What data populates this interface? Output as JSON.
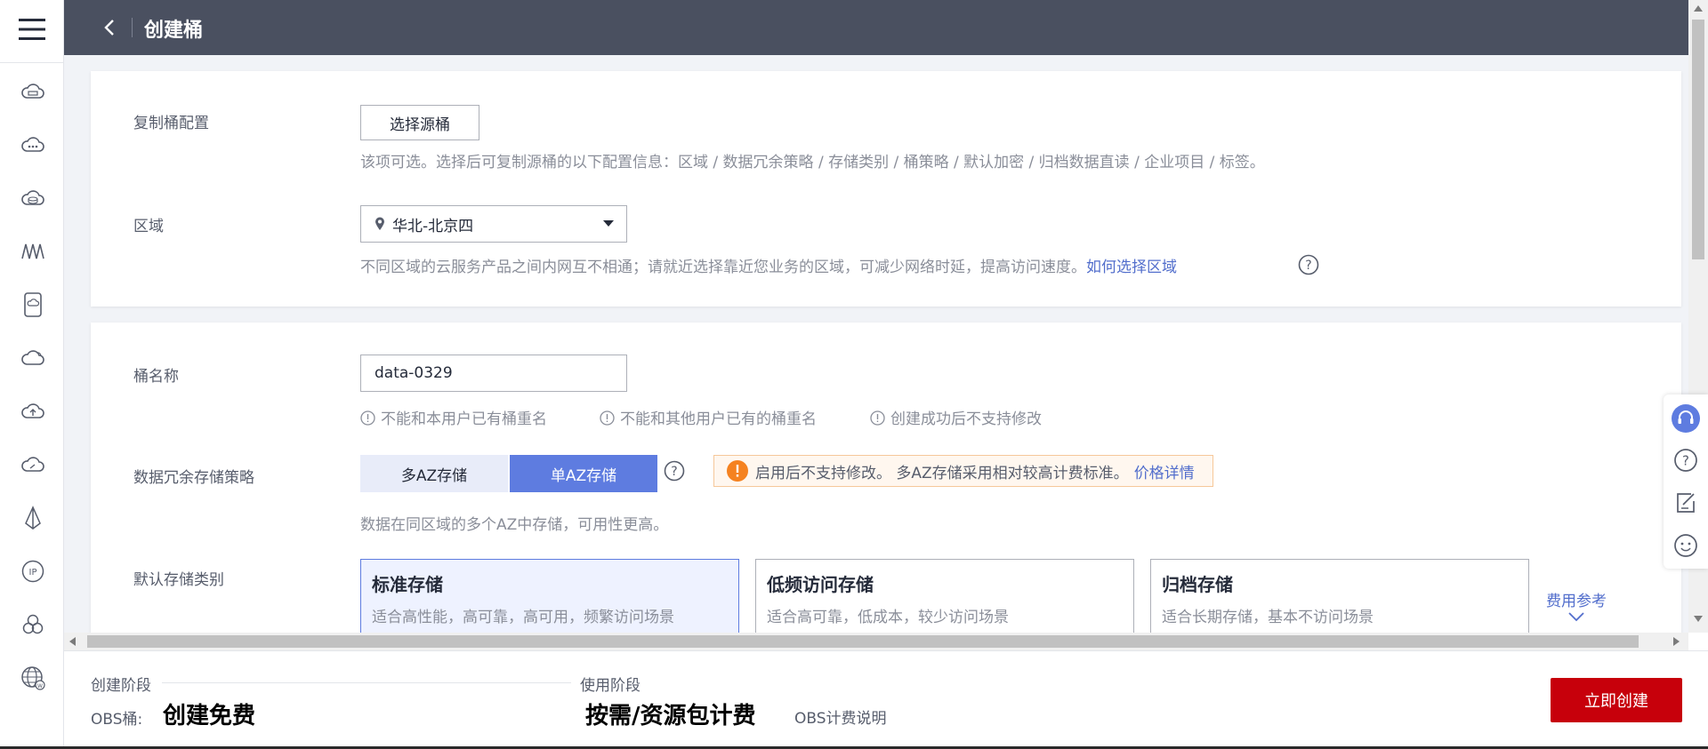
{
  "header": {
    "title": "创建桶"
  },
  "rail": {
    "items": [
      {
        "icon": "cloud-server-icon"
      },
      {
        "icon": "cloud-more-icon"
      },
      {
        "icon": "cloud-database-icon"
      },
      {
        "icon": "network-icon"
      },
      {
        "icon": "storage-device-icon"
      },
      {
        "icon": "cloud-outline-icon"
      },
      {
        "icon": "cloud-upload-icon"
      },
      {
        "icon": "cloud-gauge-icon"
      },
      {
        "icon": "deploy-icon"
      },
      {
        "icon": "ip-icon"
      },
      {
        "icon": "cluster-icon"
      },
      {
        "icon": "web-globe-icon"
      }
    ]
  },
  "card1": {
    "copy": {
      "label": "复制桶配置",
      "button": "选择源桶",
      "hint": "该项可选。选择后可复制源桶的以下配置信息：区域 / 数据冗余策略 / 存储类别 / 桶策略 / 默认加密 / 归档数据直读 / 企业项目 / 标签。"
    },
    "region": {
      "label": "区域",
      "value": "华北-北京四",
      "hint": "不同区域的云服务产品之间内网互不相通；请就近选择靠近您业务的区域，可减少网络时延，提高访问速度。",
      "link": "如何选择区域"
    }
  },
  "card2": {
    "name": {
      "label": "桶名称",
      "value": "data-0329",
      "rules": [
        "不能和本用户已有桶重名",
        "不能和其他用户已有的桶重名",
        "创建成功后不支持修改"
      ]
    },
    "redundancy": {
      "label": "数据冗余存储策略",
      "options": [
        "多AZ存储",
        "单AZ存储"
      ],
      "selected": "单AZ存储",
      "warning": "启用后不支持修改。 多AZ存储采用相对较高计费标准。",
      "warning_link": "价格详情",
      "hint": "数据在同区域的多个AZ中存储，可用性更高。"
    },
    "storage_class": {
      "label": "默认存储类别",
      "tiles": [
        {
          "title": "标准存储",
          "desc": "适合高性能，高可靠，高可用，频繁访问场景"
        },
        {
          "title": "低频访问存储",
          "desc": "适合高可靠，低成本，较少访问场景"
        },
        {
          "title": "归档存储",
          "desc": "适合长期存储，基本不访问场景"
        }
      ],
      "selected": "标准存储",
      "fee_link": "费用参考"
    }
  },
  "footer": {
    "create_stage": "创建阶段",
    "obs_label": "OBS桶:",
    "create_free": "创建免费",
    "use_stage": "使用阶段",
    "billing": "按需/资源包计费",
    "billing_link": "OBS计费说明",
    "create_button": "立即创建"
  },
  "colors": {
    "header_bg": "#4a5060",
    "accent": "#5e7ce0",
    "primary_button": "#c7000b",
    "warning": "#f58220",
    "link": "#526ecc"
  }
}
